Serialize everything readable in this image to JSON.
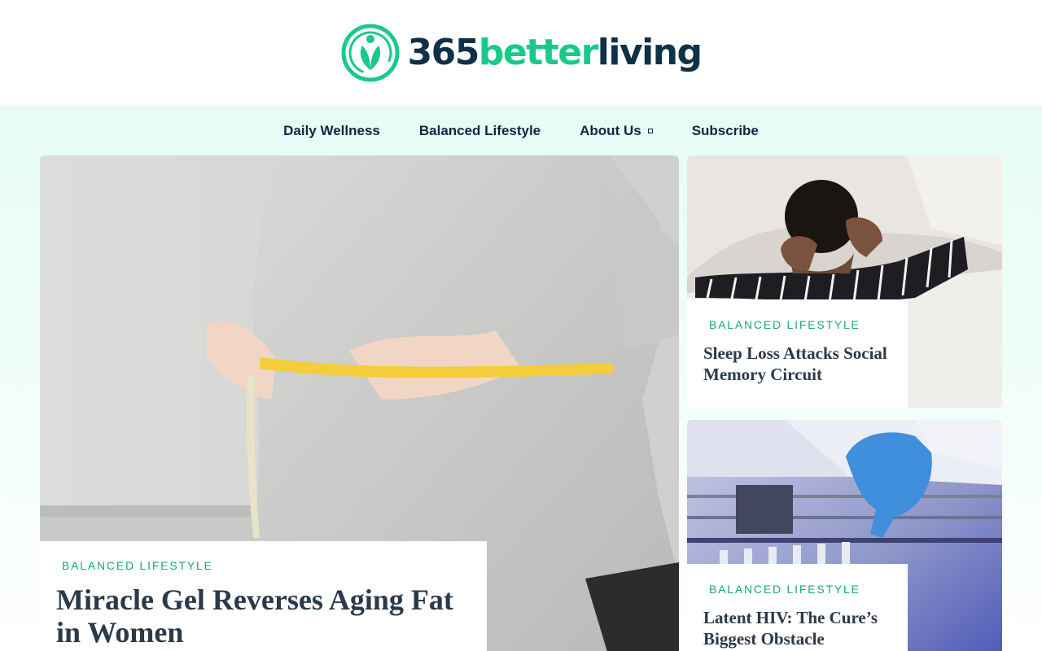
{
  "site": {
    "logo_number": "365",
    "logo_better": "better",
    "logo_living": "living",
    "logo_icon": "leaf-person-icon",
    "brand_color": "#19c98a",
    "dark_color": "#0f3146"
  },
  "nav": {
    "items": [
      {
        "label": "Daily Wellness"
      },
      {
        "label": "Balanced Lifestyle"
      },
      {
        "label": "About Us",
        "has_dropdown": true
      },
      {
        "label": "Subscribe"
      }
    ]
  },
  "featured": {
    "category": "BALANCED LIFESTYLE",
    "title": "Miracle Gel Reverses Aging Fat in Women",
    "image": "woman-measuring-waist-photo"
  },
  "side_articles": [
    {
      "category": "BALANCED LIFESTYLE",
      "title": "Sleep Loss Attacks Social Memory Circuit",
      "image": "child-covering-ears-in-bed-photo"
    },
    {
      "category": "BALANCED LIFESTYLE",
      "title": "Latent HIV: The Cure’s Biggest Obstacle",
      "image": "gloved-hand-lab-vials-photo"
    }
  ]
}
